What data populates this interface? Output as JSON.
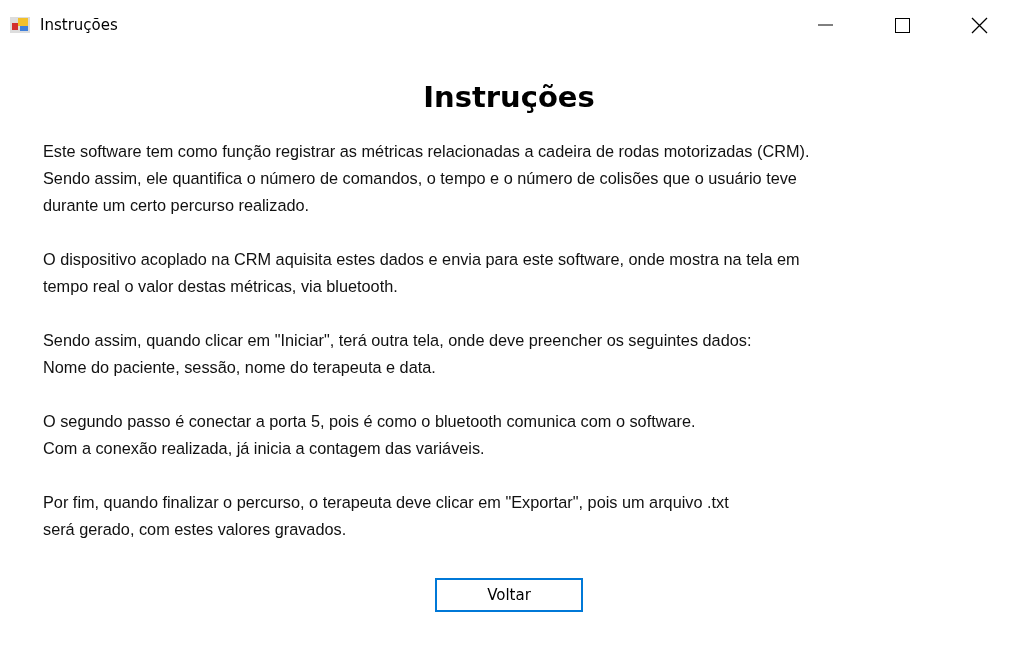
{
  "window": {
    "title": "Instruções"
  },
  "heading": "Instruções",
  "paragraphs": [
    "Este software tem como função registrar as métricas relacionadas a cadeira de rodas motorizadas (CRM).\nSendo assim, ele quantifica o número de comandos, o tempo e o número de colisões que o usuário teve\ndurante um certo percurso realizado.",
    "O dispositivo acoplado na CRM aquisita estes dados e envia para este software, onde mostra na tela em\ntempo real o valor destas métricas, via bluetooth.",
    "Sendo assim, quando clicar em \"Iniciar\", terá outra tela, onde deve preencher os seguintes dados:\nNome do paciente, sessão, nome do terapeuta e data.",
    "O segundo passo é conectar a porta 5, pois é como o bluetooth comunica com o software.\nCom a conexão realizada, já inicia a contagem das variáveis.",
    "Por fim, quando finalizar o percurso, o terapeuta deve clicar em \"Exportar\", pois um arquivo .txt\nserá gerado, com estes valores gravados."
  ],
  "buttons": [
    {
      "label": "Voltar",
      "focused": true
    }
  ]
}
